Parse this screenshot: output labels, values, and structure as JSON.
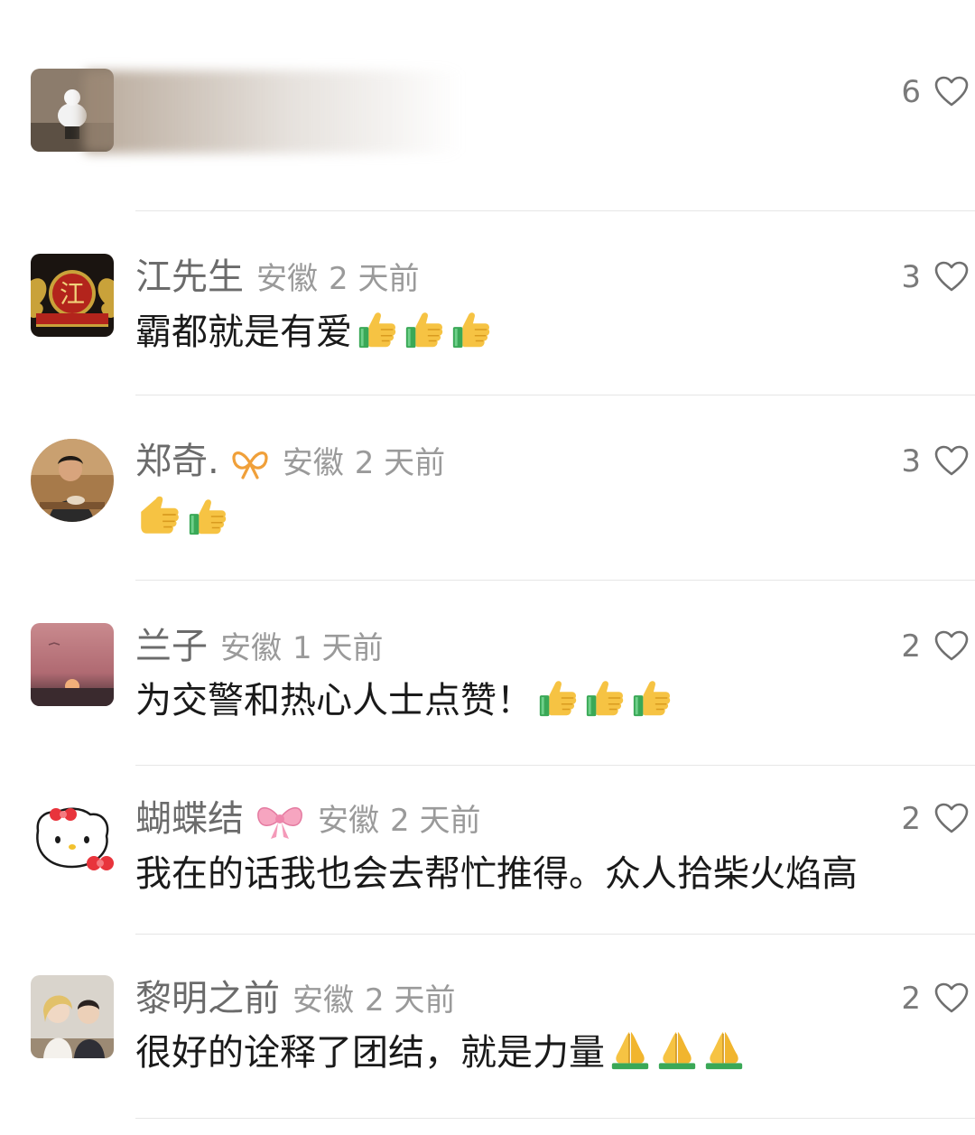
{
  "comments": [
    {
      "name": "",
      "location": "",
      "time": "",
      "text": "",
      "likes": "6",
      "avatar": "white-figure-photo",
      "blurred": true
    },
    {
      "name": "江先生",
      "location": "安徽",
      "time": "2 天前",
      "text": "霸都就是有爱",
      "emoji": [
        "thumbs-up",
        "thumbs-up",
        "thumbs-up"
      ],
      "likes": "3",
      "avatar": "red-seal-dragon",
      "avatar_char": "江"
    },
    {
      "name": "郑奇.",
      "location": "安徽",
      "time": "2 天前",
      "text": "",
      "emoji": [
        "thumbs-up",
        "thumbs-up"
      ],
      "likes": "3",
      "avatar": "man-photo",
      "badge": "orange-ribbon"
    },
    {
      "name": "兰子",
      "location": "安徽",
      "time": "1 天前",
      "text": "为交警和热心人士点赞！",
      "emoji": [
        "thumbs-up",
        "thumbs-up",
        "thumbs-up"
      ],
      "likes": "2",
      "avatar": "sunset-photo"
    },
    {
      "name": "蝴蝶结",
      "location": "安徽",
      "time": "2 天前",
      "text": "我在的话我也会去帮忙推得。众人拾柴火焰高",
      "likes": "2",
      "avatar": "hello-kitty",
      "badge": "pink-bow"
    },
    {
      "name": "黎明之前",
      "location": "安徽",
      "time": "2 天前",
      "text": "很好的诠释了团结，就是力量",
      "emoji": [
        "folded-hands",
        "folded-hands",
        "folded-hands"
      ],
      "likes": "2",
      "avatar": "couple-photo"
    }
  ],
  "colors": {
    "username": "#6b6b6b",
    "meta": "#9a9a9a",
    "text": "#1a1a1a",
    "divider": "#e6e6e6",
    "emoji_yellow": "#f6c343",
    "emoji_green": "#3aa857"
  }
}
